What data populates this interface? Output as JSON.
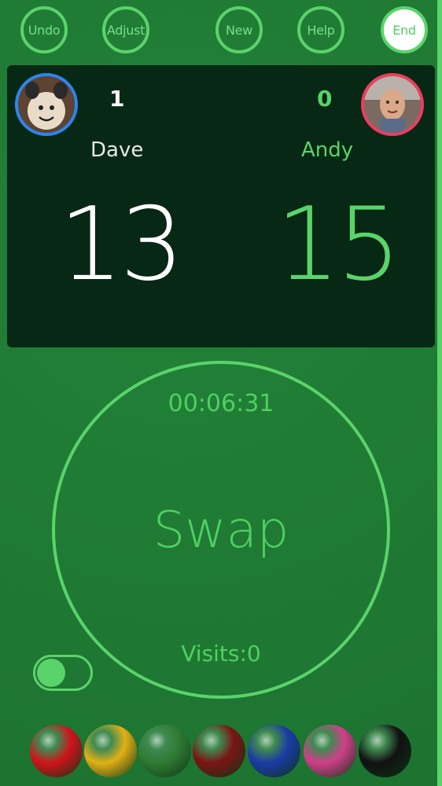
{
  "toolbar": {
    "undo": "Undo",
    "adjust": "Adjust",
    "new": "New",
    "help": "Help",
    "end": "End"
  },
  "players": {
    "dave": {
      "name": "Dave",
      "frames": "1",
      "score": "13",
      "ring_color": "#2b86f0"
    },
    "andy": {
      "name": "Andy",
      "frames": "0",
      "score": "15",
      "ring_color": "#f03b60"
    }
  },
  "center": {
    "timer": "00:06:31",
    "swap_label": "Swap",
    "visits": "Visits:0"
  },
  "toggle": {
    "on": true
  },
  "balls": [
    {
      "name": "red-ball",
      "color": "#d0131a"
    },
    {
      "name": "yellow-ball",
      "color": "#e2b017"
    },
    {
      "name": "green-ball",
      "color": "#2f7a33"
    },
    {
      "name": "brown-ball",
      "color": "#7b1414"
    },
    {
      "name": "blue-ball",
      "color": "#1b3aa6"
    },
    {
      "name": "pink-ball",
      "color": "#d13e8a"
    },
    {
      "name": "black-ball",
      "color": "#111111"
    }
  ],
  "colors": {
    "accent": "#5ad36b",
    "felt": "#1f7a34",
    "board": "#062814"
  }
}
